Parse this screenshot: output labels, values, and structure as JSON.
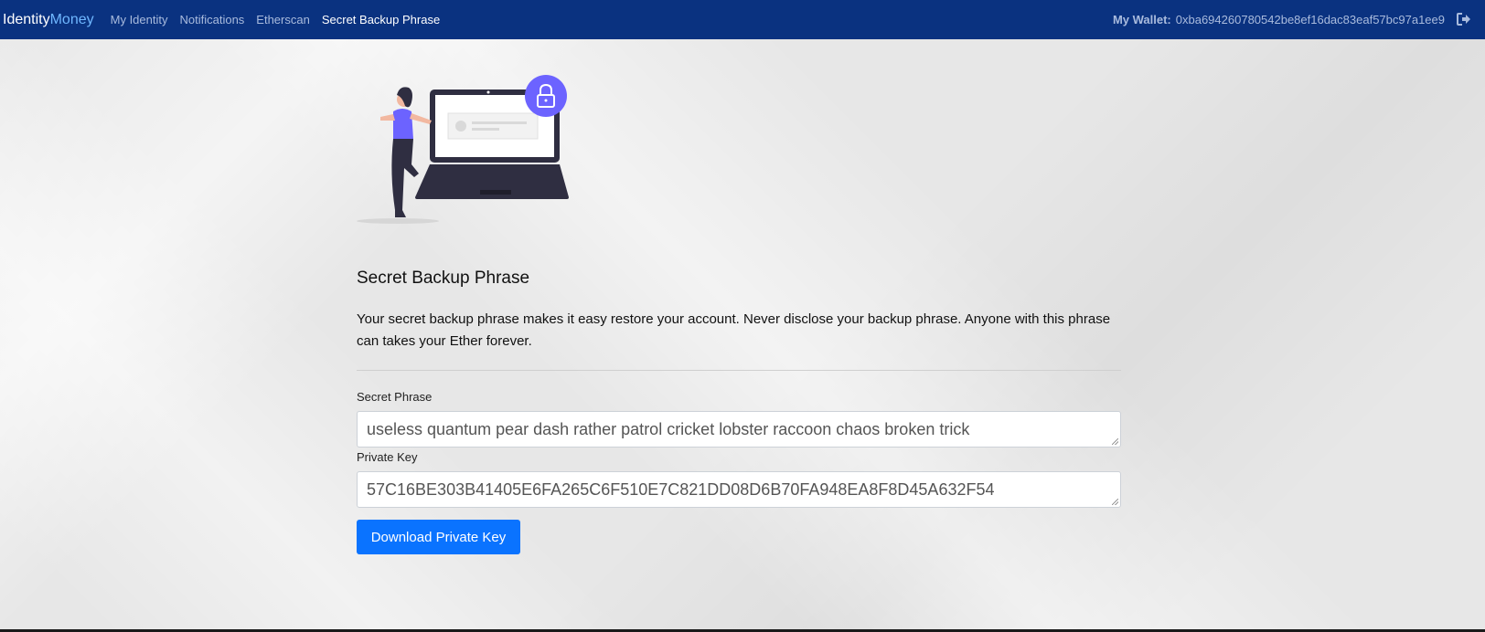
{
  "navbar": {
    "brand_part1": "Identity",
    "brand_part2": "Money",
    "links": [
      {
        "label": "My Identity"
      },
      {
        "label": "Notifications"
      },
      {
        "label": "Etherscan"
      },
      {
        "label": "Secret Backup Phrase",
        "active": true
      }
    ],
    "wallet_label": "My Wallet:",
    "wallet_address": "0xba694260780542be8ef16dac83eaf57bc97a1ee9",
    "logout_icon": "sign-out-icon"
  },
  "main": {
    "illustration": "woman-with-locked-laptop-illustration",
    "title": "Secret Backup Phrase",
    "description": "Your secret backup phrase makes it easy restore your account. Never disclose your backup phrase. Anyone with this phrase can takes your Ether forever.",
    "secret_phrase_label": "Secret Phrase",
    "secret_phrase_value": "useless quantum pear dash rather patrol cricket lobster raccoon chaos broken trick",
    "private_key_label": "Private Key",
    "private_key_value": "57C16BE303B41405E6FA265C6F510E7C821DD08D6B70FA948EA8F8D45A632F54",
    "download_button": "Download Private Key"
  },
  "colors": {
    "navbar_bg": "#0a3280",
    "brand_accent": "#6fb7ff",
    "button_bg": "#0a73ff",
    "illustration_accent": "#6c63ff"
  }
}
